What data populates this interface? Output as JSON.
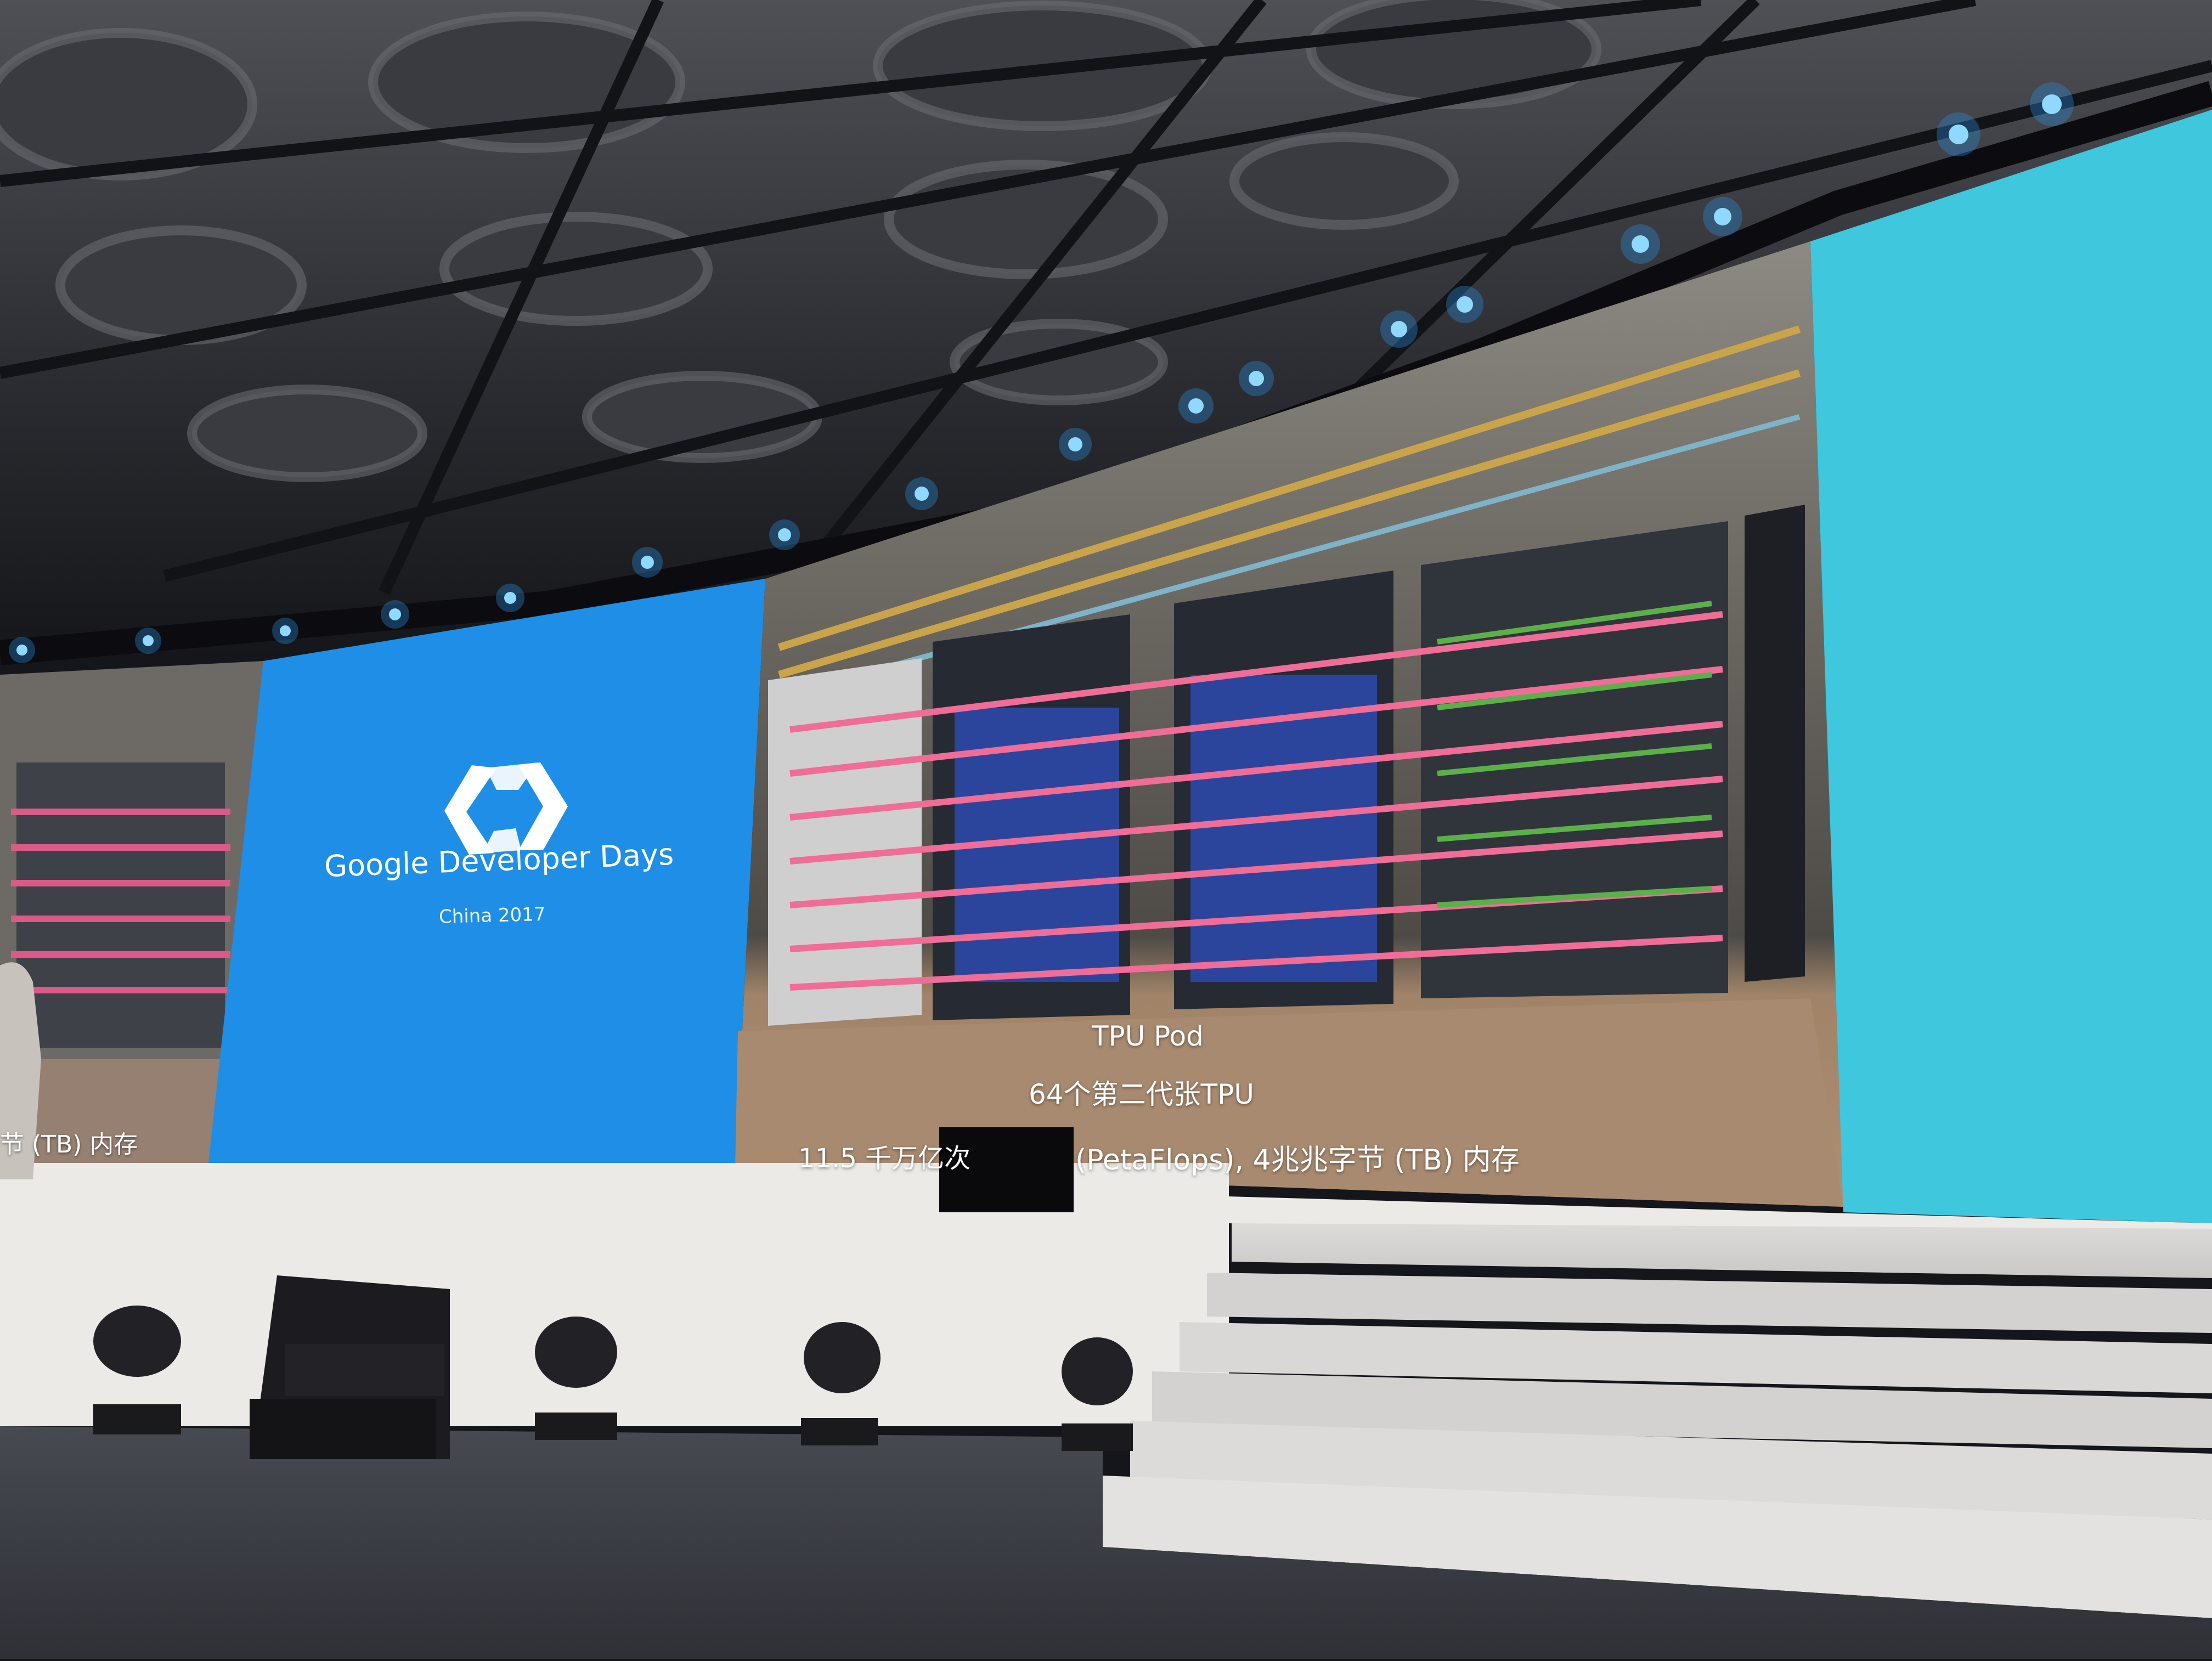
{
  "left_screen": {
    "event_title": "Google Developer Days",
    "event_subtitle": "China 2017",
    "logo": "gdd-chevron-logo"
  },
  "center_screen": {
    "caption_title": "TPU Pod",
    "caption_tpu": "64个第二代张TPU",
    "caption_specs_left": "11.5 千万亿次",
    "caption_specs_right": "(PetaFlops), 4兆兆字节 (TB) 内存"
  },
  "far_left_screen": {
    "partial_caption": "节 (TB) 内存"
  },
  "colors": {
    "blue_screen": "#1f8ee6",
    "cyan_screen": "#3ec7dd",
    "stage_front": "#eceae6",
    "floor": "#3b3e44"
  },
  "icons": [
    "gdd-chevron-logo",
    "stage-spotlight-icon",
    "speaker-box-icon"
  ]
}
